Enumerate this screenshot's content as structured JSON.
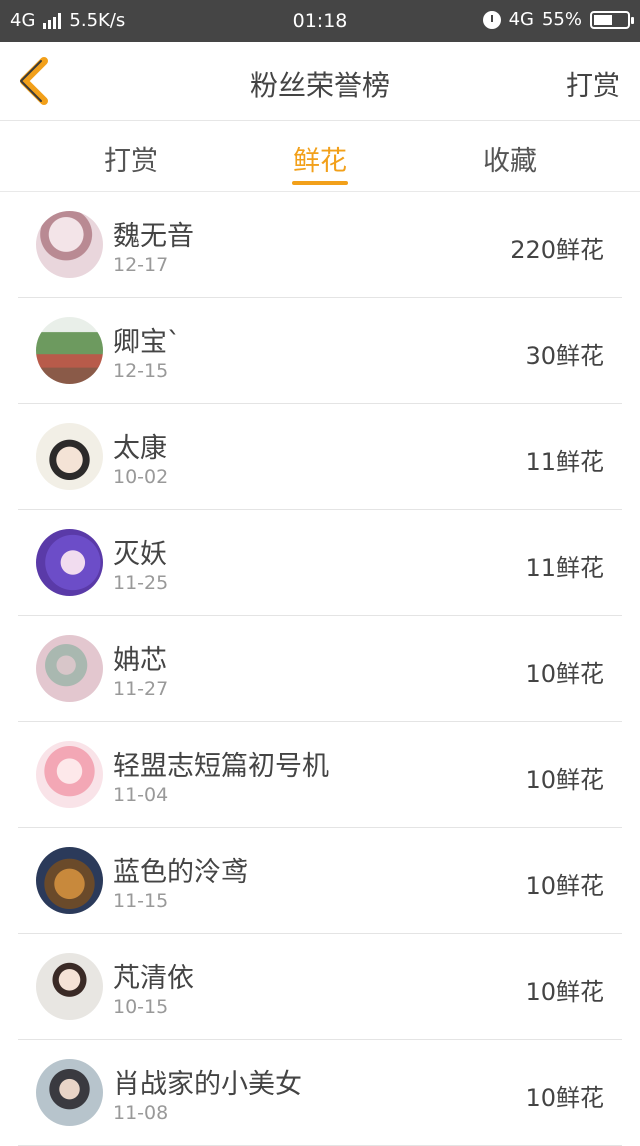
{
  "status_bar": {
    "network": "4G",
    "speed": "5.5K/s",
    "time": "01:18",
    "network_right": "4G",
    "battery": "55%",
    "battery_level": 0.55
  },
  "header": {
    "title": "粉丝荣誉榜",
    "action": "打赏"
  },
  "tabs": [
    {
      "label": "打赏",
      "active": false
    },
    {
      "label": "鲜花",
      "active": true
    },
    {
      "label": "收藏",
      "active": false
    }
  ],
  "colors": {
    "accent": "#f2a01a",
    "status_bar": "#454545",
    "text": "#444444",
    "subtext": "#999999"
  },
  "fans": [
    {
      "name": "魏无音",
      "date": "12-17",
      "amount": "220鲜花"
    },
    {
      "name": "卿宝`",
      "date": "12-15",
      "amount": "30鲜花"
    },
    {
      "name": "太康",
      "date": "10-02",
      "amount": "11鲜花"
    },
    {
      "name": "灭妖",
      "date": "11-25",
      "amount": "11鲜花"
    },
    {
      "name": "姌芯",
      "date": "11-27",
      "amount": "10鲜花"
    },
    {
      "name": "轻盟志短篇初号机",
      "date": "11-04",
      "amount": "10鲜花"
    },
    {
      "name": "蓝色的泠鸢",
      "date": "11-15",
      "amount": "10鲜花"
    },
    {
      "name": "芃清依",
      "date": "10-15",
      "amount": "10鲜花"
    },
    {
      "name": "肖战家的小美女",
      "date": "11-08",
      "amount": "10鲜花"
    }
  ]
}
